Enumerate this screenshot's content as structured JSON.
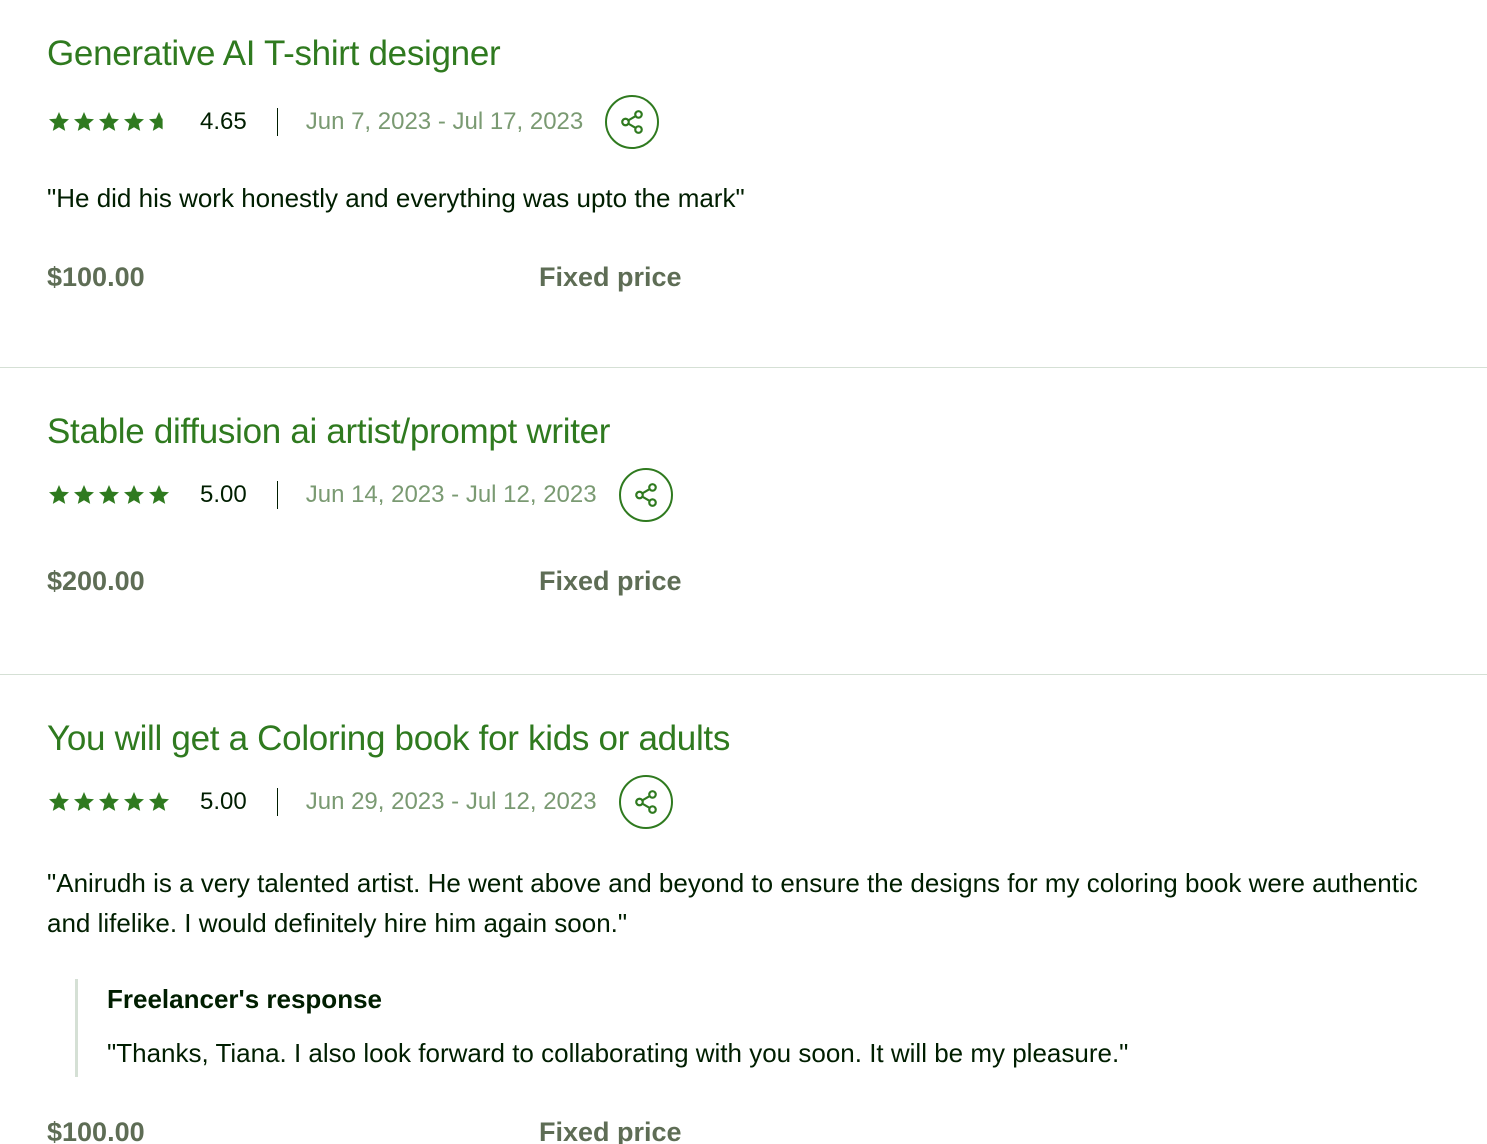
{
  "colors": {
    "accent": "#2f7a1f",
    "date": "#7a9a72",
    "price": "#5e6d55",
    "divider": "#d5e0d5"
  },
  "jobs": [
    {
      "title": "Generative AI T-shirt designer",
      "rating": "4.65",
      "stars_filled": 4.65,
      "dates": "Jun 7, 2023 - Jul 17, 2023",
      "feedback": "\"He did his work honestly and everything was upto the mark\"",
      "price": "$100.00",
      "price_type": "Fixed price"
    },
    {
      "title": "Stable diffusion ai artist/prompt writer",
      "rating": "5.00",
      "stars_filled": 5,
      "dates": "Jun 14, 2023 - Jul 12, 2023",
      "price": "$200.00",
      "price_type": "Fixed price"
    },
    {
      "title": "You will get a Coloring book for kids or adults",
      "rating": "5.00",
      "stars_filled": 5,
      "dates": "Jun 29, 2023 - Jul 12, 2023",
      "feedback": "\"Anirudh is a very talented artist. He went above and beyond to ensure the designs for my coloring book were authentic and lifelike. I would definitely hire him again soon.\"",
      "response_title": "Freelancer's response",
      "response_text": "\"Thanks, Tiana. I also look forward to collaborating with you soon. It will be my pleasure.\"",
      "price": "$100.00",
      "price_type": "Fixed price"
    }
  ],
  "icons": {
    "star": "star-icon",
    "share": "share-icon"
  }
}
